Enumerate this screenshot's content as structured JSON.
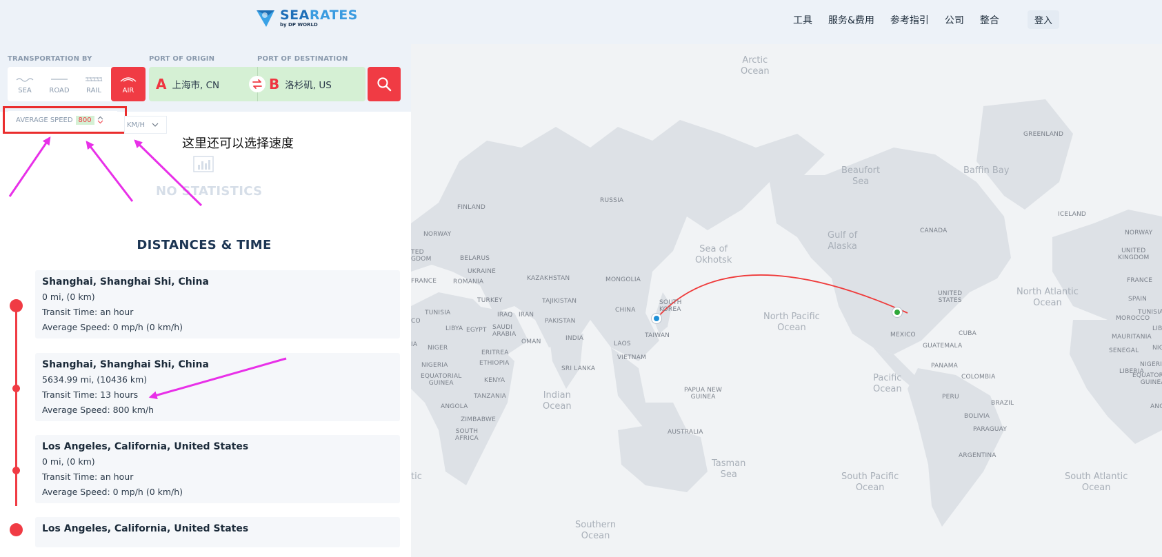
{
  "header": {
    "logo": {
      "name_part1": "SEA",
      "name_part2": "RATES",
      "sub": "by DP WORLD"
    },
    "nav": [
      "工具",
      "服务&费用",
      "参考指引",
      "公司",
      "整合"
    ],
    "login": "登入"
  },
  "controls": {
    "transport_label": "TRANSPORTATION BY",
    "origin_label": "PORT OF ORIGIN",
    "destination_label": "PORT OF DESTINATION",
    "modes": [
      {
        "label": "SEA",
        "icon": "wave-icon",
        "active": false
      },
      {
        "label": "ROAD",
        "icon": "road-icon",
        "active": false
      },
      {
        "label": "RAIL",
        "icon": "rail-icon",
        "active": false
      },
      {
        "label": "AIR",
        "icon": "plane-icon",
        "active": true
      }
    ],
    "origin": {
      "letter": "A",
      "value": "上海市, CN"
    },
    "destination": {
      "letter": "B",
      "value": "洛杉矶, US"
    },
    "speed": {
      "label": "AVERAGE SPEED",
      "value": "800",
      "unit": "KM/H"
    }
  },
  "annotation": {
    "hint": "这里还可以选择速度"
  },
  "stats": {
    "empty": "NO STATISTICS"
  },
  "distances": {
    "title": "DISTANCES & TIME",
    "items": [
      {
        "title": "Shanghai, Shanghai Shi, China",
        "distance": "0 mi, (0 km)",
        "transit": "Transit Time: an hour",
        "speed": "Average Speed: 0 mp/h (0 km/h)"
      },
      {
        "title": "Shanghai, Shanghai Shi, China",
        "distance": "5634.99 mi, (10436 km)",
        "transit": "Transit Time: 13 hours",
        "speed": "Average Speed: 800 km/h"
      },
      {
        "title": "Los Angeles, California, United States",
        "distance": "0 mi, (0 km)",
        "transit": "Transit Time: an hour",
        "speed": "Average Speed: 0 mp/h (0 km/h)"
      },
      {
        "title": "Los Angeles, California, United States"
      }
    ]
  },
  "map": {
    "labels": {
      "russia": "RUSSIA",
      "finland": "FINLAND",
      "norway_w": "NORWAY",
      "uk_w": "TED\nGDOM",
      "belarus": "BELARUS",
      "ukraine": "UKRAINE",
      "france_w": "FRANCE",
      "romania": "ROMANIA",
      "kazakhstan": "KAZAKHSTAN",
      "mongolia": "MONGOLIA",
      "turkey": "TURKEY",
      "tajikistan": "TAJIKISTAN",
      "tunisia_w": "TUNISIA",
      "iraq": "IRAQ",
      "iran": "IRAN",
      "pakistan": "PAKISTAN",
      "china": "CHINA",
      "south_korea": "SOUTH\nKOREA",
      "libya": "LIBYA",
      "egypt": "EGYPT",
      "saudi": "SAUDI\nARABIA",
      "india": "INDIA",
      "oman": "OMAN",
      "taiwan": "TAIWAN",
      "laos": "LAOS",
      "niger_w": "NIGER",
      "eritrea": "ERITREA",
      "nigeria_w": "NIGERIA",
      "ethiopia": "ETHIOPIA",
      "vietnam": "VIETNAM",
      "sri_lanka": "SRI LANKA",
      "eq_guinea_w": "EQUATORIAL\nGUINEA",
      "kenya": "KENYA",
      "tanzania": "TANZANIA",
      "papua": "PAPUA NEW\nGUINEA",
      "angola": "ANGOLA",
      "zimbabwe": "ZIMBABWE",
      "south_africa": "SOUTH\nAFRICA",
      "australia": "AUSTRALIA",
      "greenland": "GREENLAND",
      "canada": "CANADA",
      "iceland": "ICELAND",
      "norway_e": "NORWAY",
      "united_states": "UNITED\nSTATES",
      "uk_e": "UNITED\nKINGDOM",
      "france_e": "FRANCE",
      "spain": "SPAIN",
      "mexico": "MEXICO",
      "cuba": "CUBA",
      "morocco": "MOROCCO",
      "tunisia_e": "TUNISIA",
      "guatemala": "GUATEMALA",
      "mauritania": "MAURITANIA",
      "panama": "PANAMA",
      "senegal": "SENEGAL",
      "nigeria_e": "NIGERIA",
      "colombia": "COLOMBIA",
      "liberia": "LIBERIA",
      "eq_guinea_e": "EQUATORIAL\nGUINEA",
      "peru": "PERU",
      "brazil": "BRAZIL",
      "bolivia": "BOLIVIA",
      "paraguay": "PARAGUAY",
      "argentina": "ARGENTINA",
      "libya_e": "LIB",
      "niger_e": "NIG",
      "angola_e": "ANG",
      "co_w": "CO",
      "ia_w": "IA"
    },
    "oceans": {
      "arctic": "Arctic\nOcean",
      "beaufort": "Beaufort\nSea",
      "baffin": "Baffin Bay",
      "okhotsk": "Sea of\nOkhotsk",
      "alaska": "Gulf of\nAlaska",
      "north_pacific": "North Pacific\nOcean",
      "north_atlantic": "North Atlantic\nOcean",
      "indian": "Indian\nOcean",
      "pacific": "Pacific\nOcean",
      "tasman": "Tasman\nSea",
      "south_pacific": "South Pacific\nOcean",
      "south_atlantic": "South Atlantic\nOcean",
      "southern": "Southern\nOcean",
      "tic_w": "tic"
    }
  },
  "colors": {
    "accent": "#f03b44",
    "origin_pin": "#1e8fd6",
    "destination_pin": "#2fa83a",
    "od_bg": "#d5f0d4",
    "annotation": "#e830e8"
  }
}
